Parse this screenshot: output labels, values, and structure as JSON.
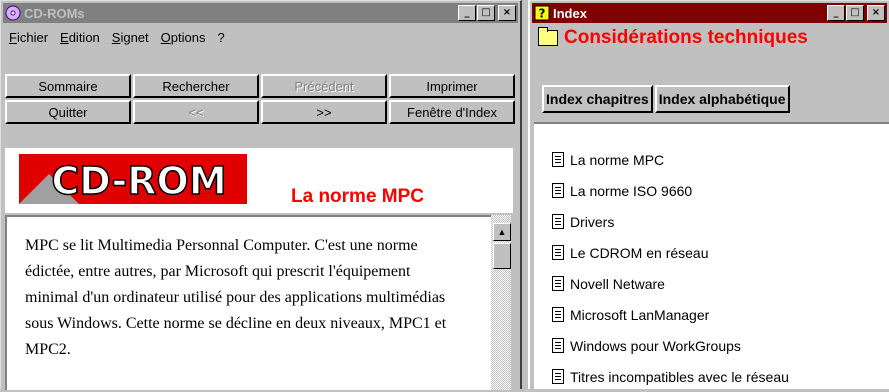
{
  "main_window": {
    "title": "CD-ROMs",
    "menu": [
      "Fichier",
      "Edition",
      "Signet",
      "Options",
      "?"
    ],
    "buttons": [
      {
        "label": "Sommaire",
        "enabled": true
      },
      {
        "label": "Rechercher",
        "enabled": true
      },
      {
        "label": "Précédent",
        "enabled": false
      },
      {
        "label": "Imprimer",
        "enabled": true
      },
      {
        "label": "Quitter",
        "enabled": true
      },
      {
        "label": "<<",
        "enabled": false
      },
      {
        "label": ">>",
        "enabled": true
      },
      {
        "label": "Fenêtre d'Index",
        "enabled": true
      }
    ],
    "logo_text": "CD-ROM",
    "topic_title": "La norme MPC",
    "body_text": "MPC se lit Multimedia Personnal Computer. C'est une norme édictée, entre autres, par Microsoft qui prescrit l'équipement minimal d'un ordinateur utilisé pour des applications multimédias sous Windows. Cette norme se décline en deux niveaux, MPC1 et MPC2."
  },
  "index_window": {
    "title": "Index",
    "heading": "Considérations techniques",
    "tabs": [
      "Index chapitres",
      "Index alphabétique"
    ],
    "items": [
      "La norme MPC",
      "La norme ISO 9660",
      "Drivers",
      "Le CDROM en réseau",
      "Novell Netware",
      "Microsoft LanManager",
      "Windows pour WorkGroups",
      "Titres incompatibles avec le réseau"
    ]
  },
  "colors": {
    "inactive_title": "#808080",
    "active_title": "#800000",
    "accent_red": "#ff0000",
    "face": "#c0c0c0"
  }
}
